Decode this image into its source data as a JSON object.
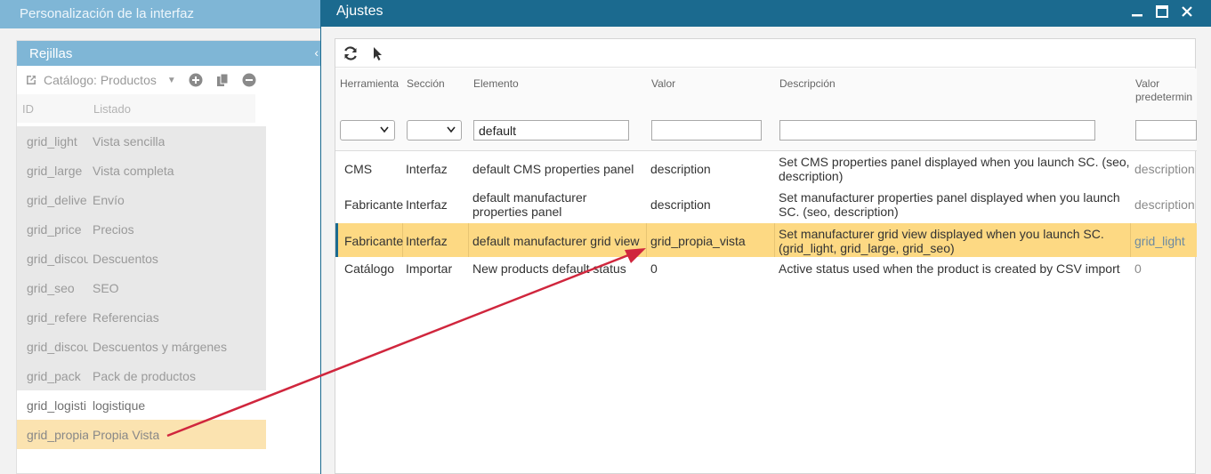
{
  "background_window": {
    "title": "Personalización de la interfaz",
    "panel_title": "Rejillas",
    "toolbar": {
      "catalog_label": "Catálogo: Productos"
    },
    "columns": {
      "id": "ID",
      "listado": "Listado"
    },
    "rows": [
      {
        "id": "grid_light",
        "listado": "Vista sencilla"
      },
      {
        "id": "grid_large",
        "listado": "Vista completa"
      },
      {
        "id": "grid_delive",
        "listado": "Envío"
      },
      {
        "id": "grid_price",
        "listado": "Precios"
      },
      {
        "id": "grid_discou",
        "listado": "Descuentos"
      },
      {
        "id": "grid_seo",
        "listado": "SEO"
      },
      {
        "id": "grid_refere",
        "listado": "Referencias"
      },
      {
        "id": "grid_discou",
        "listado": "Descuentos y márgenes"
      },
      {
        "id": "grid_pack",
        "listado": "Pack de productos"
      },
      {
        "id": "grid_logisti",
        "listado": "logistique"
      },
      {
        "id": "grid_propia",
        "listado": "Propia Vista"
      }
    ]
  },
  "settings_window": {
    "title": "Ajustes",
    "columns": {
      "herramienta": "Herramienta",
      "seccion": "Sección",
      "elemento": "Elemento",
      "valor": "Valor",
      "descripcion": "Descripción",
      "valor_predeterminado_1": "Valor",
      "valor_predeterminado_2": "predetermin"
    },
    "filters": {
      "elemento": "default",
      "valor": "",
      "descripcion": "",
      "valor_predeterminado": ""
    },
    "rows": [
      {
        "herramienta": "CMS",
        "seccion": "Interfaz",
        "elemento": "default CMS properties panel",
        "valor": "description",
        "descripcion": "Set CMS properties panel displayed when you launch SC. (seo, description)",
        "valor_predeterminado": "description"
      },
      {
        "herramienta": "Fabricante",
        "seccion": "Interfaz",
        "elemento": "default manufacturer properties panel",
        "valor": "description",
        "descripcion": "Set manufacturer properties panel displayed when you launch SC. (seo, description)",
        "valor_predeterminado": "description"
      },
      {
        "herramienta": "Fabricante",
        "seccion": "Interfaz",
        "elemento": "default manufacturer grid view",
        "valor": "grid_propia_vista",
        "descripcion": "Set manufacturer grid view displayed when you launch SC. (grid_light, grid_large, grid_seo)",
        "valor_predeterminado": "grid_light"
      },
      {
        "herramienta": "Catálogo",
        "seccion": "Importar",
        "elemento": "New products default status",
        "valor": "0",
        "descripcion": "Active status used when the product is created by CSV import",
        "valor_predeterminado": "0"
      }
    ]
  },
  "colors": {
    "titlebar_dark": "#1b6a8f",
    "titlebar_light": "#7fb6d6",
    "selected_row": "#fdd983",
    "annotation_arrow": "#d0263d"
  },
  "icons": {
    "external_link": "external-link-icon",
    "add": "plus-circle-icon",
    "copy": "copy-icon",
    "remove": "minus-circle-icon",
    "refresh": "refresh-icon",
    "pointer": "cursor-pointer-icon",
    "minimize": "minimize-icon",
    "maximize": "maximize-icon",
    "close": "close-icon"
  }
}
